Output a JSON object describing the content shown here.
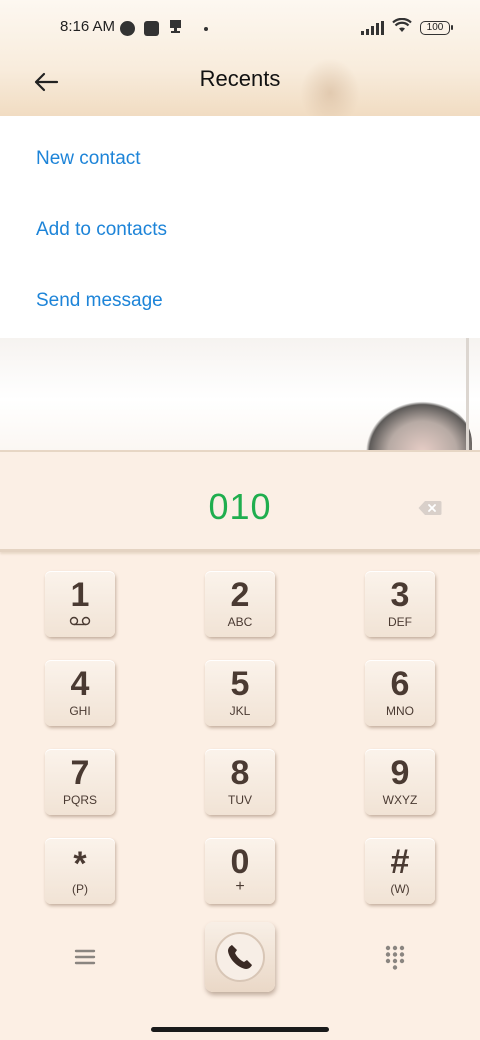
{
  "status_bar": {
    "time": "8:16 AM",
    "battery": "100"
  },
  "header": {
    "title": "Recents",
    "back_icon": "arrow-left-icon"
  },
  "actions": [
    {
      "label": "New contact"
    },
    {
      "label": "Add to contacts"
    },
    {
      "label": "Send message"
    }
  ],
  "dialer": {
    "number": "010",
    "number_color": "#1fae4e",
    "keys": [
      {
        "digit": "1",
        "letters": "o_o"
      },
      {
        "digit": "2",
        "letters": "ABC"
      },
      {
        "digit": "3",
        "letters": "DEF"
      },
      {
        "digit": "4",
        "letters": "GHI"
      },
      {
        "digit": "5",
        "letters": "JKL"
      },
      {
        "digit": "6",
        "letters": "MNO"
      },
      {
        "digit": "7",
        "letters": "PQRS"
      },
      {
        "digit": "8",
        "letters": "TUV"
      },
      {
        "digit": "9",
        "letters": "WXYZ"
      },
      {
        "digit": "*",
        "letters": "(P)"
      },
      {
        "digit": "0",
        "letters": "+"
      },
      {
        "digit": "#",
        "letters": "(W)"
      }
    ],
    "bottom_icons": [
      "menu-icon",
      "phone-call-icon",
      "dialpad-icon"
    ]
  },
  "colors": {
    "link": "#1d84d8",
    "key_text": "#4a3a32",
    "dialer_bg": "#fcefe4"
  }
}
